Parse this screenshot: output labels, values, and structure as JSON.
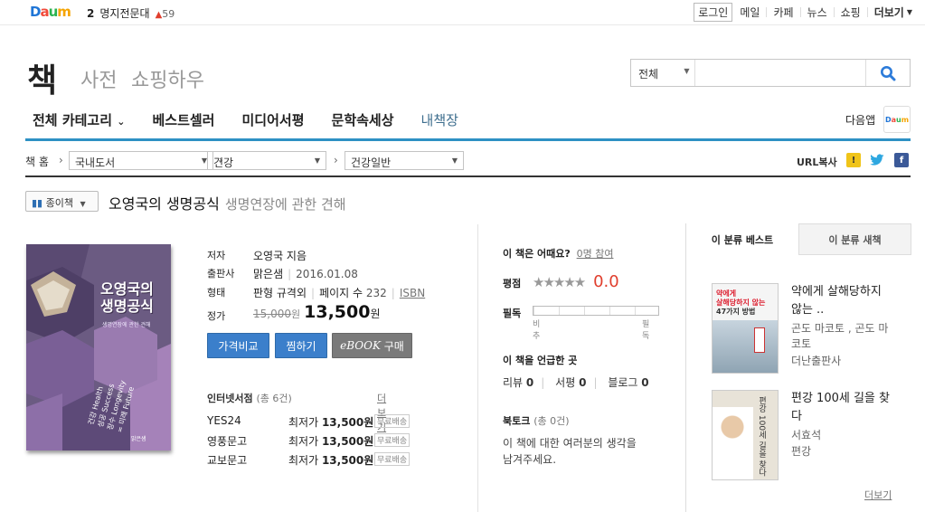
{
  "top": {
    "logo": "Daum",
    "issue_rank": "2",
    "issue_text": "명지전문대",
    "issue_up": "▲",
    "issue_count": "59",
    "nav": [
      "로그인",
      "메일",
      "카페",
      "뉴스",
      "쇼핑",
      "더보기"
    ]
  },
  "header": {
    "service_title": "책",
    "sub_services": [
      "사전",
      "쇼핑하우"
    ],
    "search_scope": "전체",
    "search_value": ""
  },
  "gnb": [
    "전체 카테고리",
    "베스트셀러",
    "미디어서평",
    "문학속세상",
    "내책장"
  ],
  "app_label": "다음앱",
  "breadcrumb": {
    "home": "책 홈",
    "levels": [
      "국내도서",
      "건강",
      "건강일반"
    ],
    "url_copy": "URL복사"
  },
  "book": {
    "type_label": "종이책",
    "title": "오영국의 생명공식",
    "subtitle": "생명연장에 관한 견해",
    "cover": {
      "title_line1": "오영국의",
      "title_line2": "생명공식",
      "subtitle": "생명연장에 관한 견해",
      "side_lines": [
        "건강 Health",
        "성공 Success",
        "장수 Longevity",
        "= 미래 Future"
      ],
      "publisher": "맑은샘"
    },
    "labels": {
      "author": "저자",
      "publisher": "출판사",
      "format": "형태",
      "price": "정가"
    },
    "author": "오영국 지음",
    "publisher": "맑은샘",
    "pub_date": "2016.01.08",
    "format_size": "판형 규격외",
    "pages_label": "페이지 수",
    "pages": "232",
    "isbn_label": "ISBN",
    "list_price": "15,000",
    "sale_price": "13,500",
    "won": "원",
    "buttons": {
      "compare": "가격비교",
      "wish": "찜하기",
      "ebook_italic": "eBOOK",
      "ebook_rest": "구매"
    }
  },
  "internet_stores": {
    "title": "인터넷서점",
    "count": "(총 6건)",
    "more": "더보기",
    "price_label": "최저가",
    "free_ship": "무료배송",
    "items": [
      {
        "name": "YES24",
        "price": "13,500원"
      },
      {
        "name": "영풍문고",
        "price": "13,500원"
      },
      {
        "name": "교보문고",
        "price": "13,500원"
      }
    ]
  },
  "rating": {
    "question": "이 책은 어때요?",
    "participants": "0명 참여",
    "score_label": "평점",
    "score": "0.0",
    "stars_filled": 0,
    "recommend_label": "필독",
    "left_label": "비추",
    "right_label": "필독",
    "mentions_title": "이 책을 언급한 곳",
    "mentions": [
      {
        "label": "리뷰",
        "count": "0"
      },
      {
        "label": "서평",
        "count": "0"
      },
      {
        "label": "블로그",
        "count": "0"
      }
    ],
    "booktalk_title": "북토크",
    "booktalk_count": "(총 0건)",
    "booktalk_desc_1": "이 책에 대한 여러분의 생각을",
    "booktalk_desc_2": "남겨주세요."
  },
  "side": {
    "tabs": [
      "이 분류 베스트",
      "이 분류 새책"
    ],
    "items": [
      {
        "title": "약에게 살해당하지 않는 ..",
        "author": "곤도 마코토 , 곤도 마코토",
        "publisher": "더난출판사",
        "cover": {
          "line1": "약에게",
          "line2": "살해당하지 않는",
          "line3": "47가지 방법"
        }
      },
      {
        "title": "편강 100세 길을 찾다",
        "author": "서효석",
        "publisher": "편강",
        "cover": {
          "line1": "편강",
          "line2": "100세",
          "line3": "길을 찾다"
        }
      }
    ],
    "more": "더보기"
  },
  "colors": {
    "accent_blue": "#2e91c4",
    "price_red": "#e03e2d",
    "button_blue": "#3b7fcb",
    "cover_purple": "#6b5b82"
  }
}
